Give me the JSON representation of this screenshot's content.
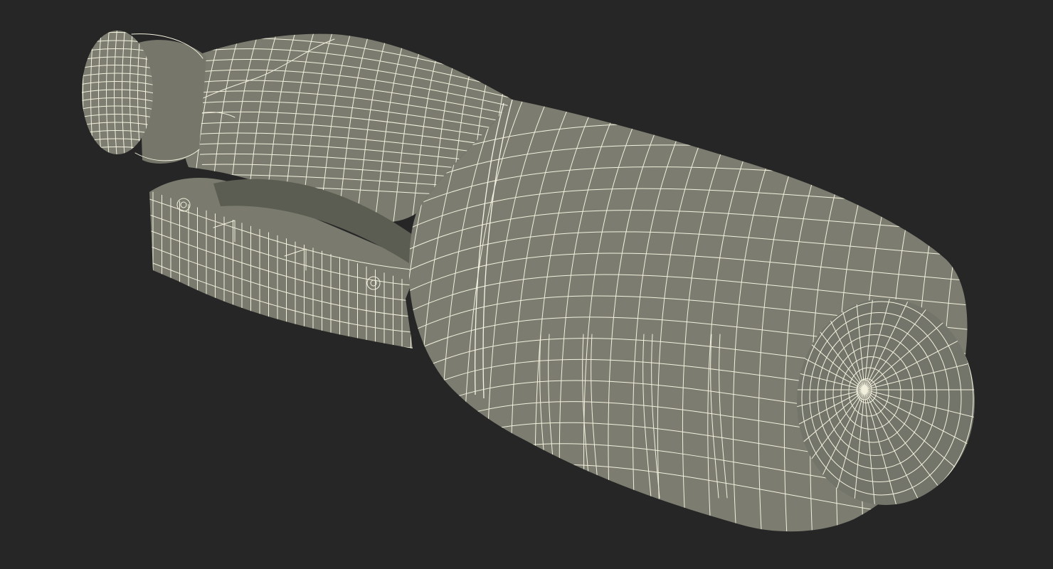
{
  "scene": {
    "model": "bottle",
    "display_mode": "wireframe-on-shaded",
    "colors": {
      "background": "#262626",
      "surface": "#7b7c6f",
      "surface_dark": "#66675b",
      "surface_light": "#8a8b7e",
      "inner": "#5c5d52",
      "wire": "#f3f1de"
    }
  }
}
